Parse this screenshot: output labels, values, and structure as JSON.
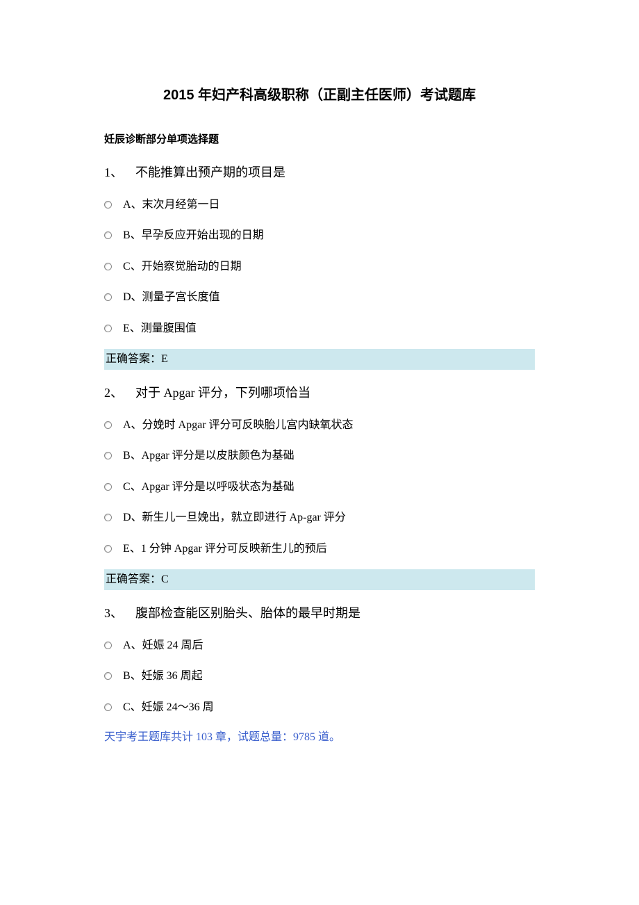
{
  "title": "2015 年妇产科高级职称（正副主任医师）考试题库",
  "section_header": "妊辰诊断部分单项选择题",
  "questions": [
    {
      "num": "1、",
      "text": "不能推算出预产期的项目是",
      "options": [
        "A、末次月经第一日",
        "B、早孕反应开始出现的日期",
        "C、开始察觉胎动的日期",
        "D、测量子宫长度值",
        "E、测量腹围值"
      ],
      "answer": "正确答案：E"
    },
    {
      "num": "2、",
      "text": "对于 Apgar 评分，下列哪项恰当",
      "options": [
        "A、分娩时 Apgar 评分可反映胎儿宫内缺氧状态",
        "B、Apgar 评分是以皮肤颜色为基础",
        "C、Apgar 评分是以呼吸状态为基础",
        "D、新生儿一旦娩出，就立即进行 Ap-gar 评分",
        "E、1 分钟 Apgar 评分可反映新生儿的预后"
      ],
      "answer": "正确答案：C"
    },
    {
      "num": "3、",
      "text": "腹部检查能区别胎头、胎体的最早时期是",
      "options": [
        "A、妊娠 24 周后",
        "B、妊娠 36 周起",
        "C、妊娠 24～36 周"
      ],
      "answer": ""
    }
  ],
  "footer_note": "天宇考王题库共计 103 章，试题总量：9785 道。"
}
